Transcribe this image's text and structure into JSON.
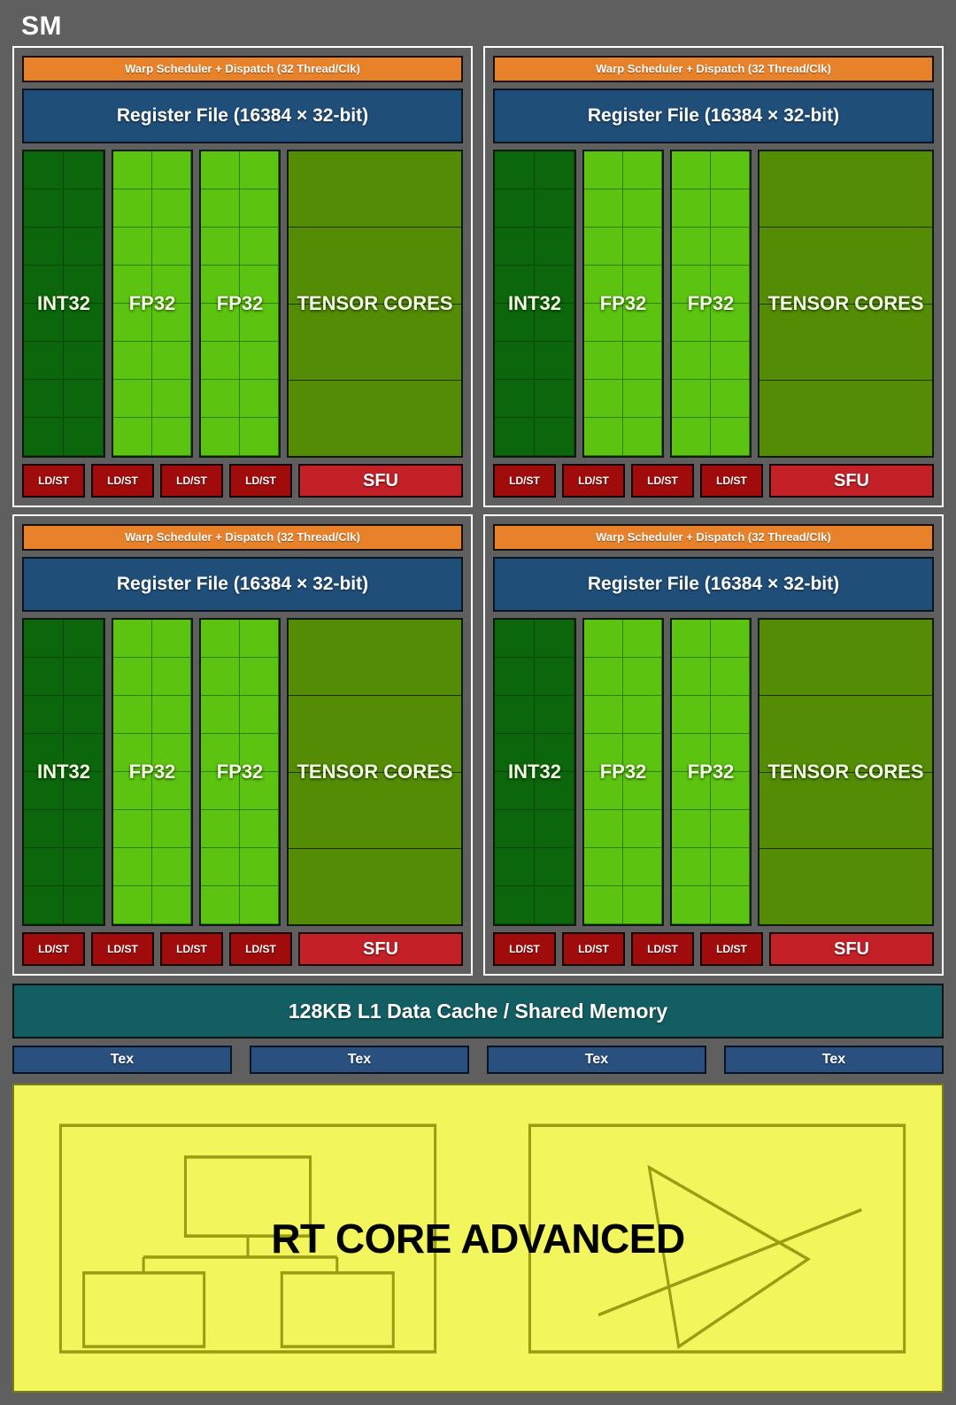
{
  "diagram": {
    "title": "SM",
    "processing_blocks": [
      {
        "warp_scheduler": "Warp Scheduler + Dispatch (32 Thread/Clk)",
        "register_file": "Register File (16384 × 32-bit)",
        "cores": [
          {
            "label": "INT32",
            "type": "int32",
            "color": "#0c660c",
            "cols": 2,
            "rows": 8
          },
          {
            "label": "FP32",
            "type": "fp32",
            "color": "#5cc410",
            "cols": 2,
            "rows": 8
          },
          {
            "label": "FP32",
            "type": "fp32",
            "color": "#5cc410",
            "cols": 2,
            "rows": 8
          },
          {
            "label": "TENSOR\nCORES",
            "type": "tensor",
            "color": "#548c06",
            "bands": 4
          }
        ],
        "ldst": [
          "LD/ST",
          "LD/ST",
          "LD/ST",
          "LD/ST"
        ],
        "sfu": "SFU"
      },
      {
        "warp_scheduler": "Warp Scheduler + Dispatch (32 Thread/Clk)",
        "register_file": "Register File (16384 × 32-bit)",
        "cores": [
          {
            "label": "INT32",
            "type": "int32",
            "color": "#0c660c",
            "cols": 2,
            "rows": 8
          },
          {
            "label": "FP32",
            "type": "fp32",
            "color": "#5cc410",
            "cols": 2,
            "rows": 8
          },
          {
            "label": "FP32",
            "type": "fp32",
            "color": "#5cc410",
            "cols": 2,
            "rows": 8
          },
          {
            "label": "TENSOR\nCORES",
            "type": "tensor",
            "color": "#548c06",
            "bands": 4
          }
        ],
        "ldst": [
          "LD/ST",
          "LD/ST",
          "LD/ST",
          "LD/ST"
        ],
        "sfu": "SFU"
      },
      {
        "warp_scheduler": "Warp Scheduler + Dispatch (32 Thread/Clk)",
        "register_file": "Register File (16384 × 32-bit)",
        "cores": [
          {
            "label": "INT32",
            "type": "int32",
            "color": "#0c660c",
            "cols": 2,
            "rows": 8
          },
          {
            "label": "FP32",
            "type": "fp32",
            "color": "#5cc410",
            "cols": 2,
            "rows": 8
          },
          {
            "label": "FP32",
            "type": "fp32",
            "color": "#5cc410",
            "cols": 2,
            "rows": 8
          },
          {
            "label": "TENSOR\nCORES",
            "type": "tensor",
            "color": "#548c06",
            "bands": 4
          }
        ],
        "ldst": [
          "LD/ST",
          "LD/ST",
          "LD/ST",
          "LD/ST"
        ],
        "sfu": "SFU"
      },
      {
        "warp_scheduler": "Warp Scheduler + Dispatch (32 Thread/Clk)",
        "register_file": "Register File (16384 × 32-bit)",
        "cores": [
          {
            "label": "INT32",
            "type": "int32",
            "color": "#0c660c",
            "cols": 2,
            "rows": 8
          },
          {
            "label": "FP32",
            "type": "fp32",
            "color": "#5cc410",
            "cols": 2,
            "rows": 8
          },
          {
            "label": "FP32",
            "type": "fp32",
            "color": "#5cc410",
            "cols": 2,
            "rows": 8
          },
          {
            "label": "TENSOR\nCORES",
            "type": "tensor",
            "color": "#548c06",
            "bands": 4
          }
        ],
        "ldst": [
          "LD/ST",
          "LD/ST",
          "LD/ST",
          "LD/ST"
        ],
        "sfu": "SFU"
      }
    ],
    "l1_cache": "128KB L1 Data Cache / Shared Memory",
    "tex_units": [
      "Tex",
      "Tex",
      "Tex",
      "Tex"
    ],
    "rt_core": {
      "label": "RT CORE ADVANCED",
      "left_panel_icon": "bvh-tree-icon",
      "right_panel_icon": "ray-triangle-intersection-icon"
    },
    "colors": {
      "background": "#5f5f5f",
      "block_border": "#ffffff",
      "warp_scheduler": "#e8822a",
      "register_file": "#1f4e79",
      "int32": "#0c660c",
      "fp32": "#5cc410",
      "tensor": "#548c06",
      "ldst": "#a00c0c",
      "sfu": "#c42028",
      "l1_cache": "#135e63",
      "tex": "#2a5080",
      "rt_core": "#f2f55c",
      "rt_core_line": "#9a9c12"
    }
  }
}
